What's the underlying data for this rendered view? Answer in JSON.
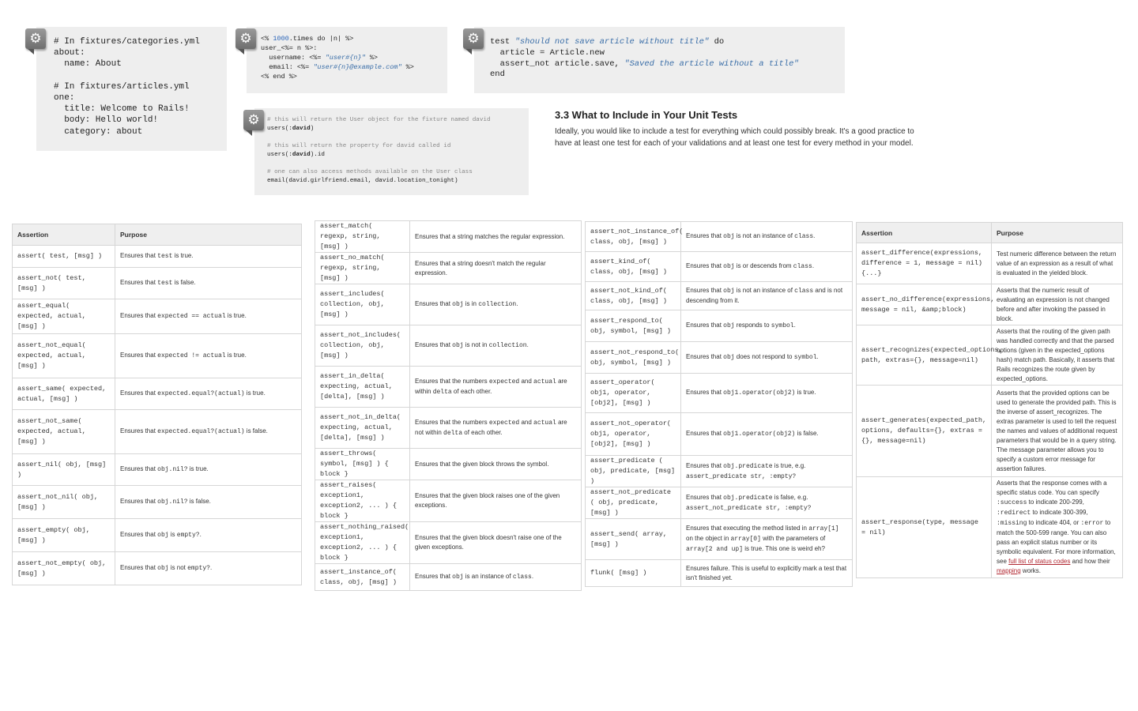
{
  "snippets": {
    "fixtures": [
      {
        "t": "# In fixtures/categories.yml"
      },
      {
        "t": "about:"
      },
      {
        "t": "  name: About"
      },
      {
        "t": ""
      },
      {
        "t": "# In fixtures/articles.yml"
      },
      {
        "t": "one:"
      },
      {
        "t": "  title: Welcome to Rails!"
      },
      {
        "t": "  body: Hello world!"
      },
      {
        "t": "  category: about"
      }
    ],
    "erb": [
      {
        "a": "<% ",
        "num": "1000",
        "b": ".times do |n| %>"
      },
      {
        "a": "user_<%= n %>:"
      },
      {
        "a": "  username: <%= ",
        "str": "\"user#{n}\"",
        "b": " %>"
      },
      {
        "a": "  email: <%= ",
        "str": "\"user#{n}@example.com\"",
        "b": " %>"
      },
      {
        "a": "<% end %>"
      }
    ],
    "test": [
      {
        "a": "test ",
        "str": "\"should not save article without title\"",
        "b": " do"
      },
      {
        "a": "  article = Article.new"
      },
      {
        "a": "  assert_not article.save, ",
        "str": "\"Saved the article without a title\""
      },
      {
        "a": "end"
      }
    ],
    "users": [
      {
        "cmt": "# this will return the User object for the fixture named david"
      },
      {
        "a": "users(:",
        "bold": "david",
        "b": ")"
      },
      {
        "a": ""
      },
      {
        "cmt": "# this will return the property for david called id"
      },
      {
        "a": "users(:",
        "bold": "david",
        "b": ").id"
      },
      {
        "a": ""
      },
      {
        "cmt": "# one can also access methods available on the User class"
      },
      {
        "a": "email(david.girlfriend.email, david.location_tonight)"
      }
    ]
  },
  "section": {
    "heading": "3.3 What to Include in Your Unit Tests",
    "paragraph": "Ideally, you would like to include a test for everything which could possibly break. It's a good practice to have at least one test for each of your validations and at least one test for every method in your model."
  },
  "table_headers": {
    "assertion": "Assertion",
    "purpose": "Purpose"
  },
  "table1": [
    {
      "m": "assert( test, [msg] )",
      "p": [
        {
          "t": "Ensures that "
        },
        {
          "c": "test"
        },
        {
          "t": " is true."
        }
      ]
    },
    {
      "m": "assert_not( test, [msg] )",
      "p": [
        {
          "t": "Ensures that "
        },
        {
          "c": "test"
        },
        {
          "t": " is false."
        }
      ]
    },
    {
      "m": "assert_equal( expected, actual, [msg] )",
      "p": [
        {
          "t": "Ensures that "
        },
        {
          "c": "expected == actual"
        },
        {
          "t": " is true."
        }
      ]
    },
    {
      "m": "assert_not_equal( expected, actual, [msg] )",
      "p": [
        {
          "t": "Ensures that "
        },
        {
          "c": "expected != actual"
        },
        {
          "t": " is true."
        }
      ]
    },
    {
      "m": "assert_same( expected, actual, [msg] )",
      "p": [
        {
          "t": "Ensures that "
        },
        {
          "c": "expected.equal?(actual)"
        },
        {
          "t": " is true."
        }
      ]
    },
    {
      "m": "assert_not_same( expected, actual, [msg] )",
      "p": [
        {
          "t": "Ensures that "
        },
        {
          "c": "expected.equal?(actual)"
        },
        {
          "t": " is false."
        }
      ]
    },
    {
      "m": "assert_nil( obj, [msg] )",
      "p": [
        {
          "t": "Ensures that "
        },
        {
          "c": "obj.nil?"
        },
        {
          "t": " is true."
        }
      ]
    },
    {
      "m": "assert_not_nil( obj, [msg] )",
      "p": [
        {
          "t": "Ensures that "
        },
        {
          "c": "obj.nil?"
        },
        {
          "t": " is false."
        }
      ]
    },
    {
      "m": "assert_empty( obj, [msg] )",
      "p": [
        {
          "t": "Ensures that "
        },
        {
          "c": "obj"
        },
        {
          "t": " is "
        },
        {
          "c": "empty?"
        },
        {
          "t": "."
        }
      ]
    },
    {
      "m": "assert_not_empty( obj, [msg] )",
      "p": [
        {
          "t": "Ensures that "
        },
        {
          "c": "obj"
        },
        {
          "t": " is not "
        },
        {
          "c": "empty?"
        },
        {
          "t": "."
        }
      ]
    }
  ],
  "table2": [
    {
      "m": "assert_match( regexp, string, [msg] )",
      "p": [
        {
          "t": "Ensures that a string matches the regular expression."
        }
      ]
    },
    {
      "m": "assert_no_match( regexp, string, [msg] )",
      "p": [
        {
          "t": "Ensures that a string doesn't match the regular expression."
        }
      ]
    },
    {
      "m": "assert_includes( collection, obj, [msg] )",
      "p": [
        {
          "t": "Ensures that "
        },
        {
          "c": "obj"
        },
        {
          "t": " is in "
        },
        {
          "c": "collection"
        },
        {
          "t": "."
        }
      ]
    },
    {
      "m": "assert_not_includes( collection, obj, [msg] )",
      "p": [
        {
          "t": "Ensures that "
        },
        {
          "c": "obj"
        },
        {
          "t": " is not in "
        },
        {
          "c": "collection"
        },
        {
          "t": "."
        }
      ]
    },
    {
      "m": "assert_in_delta( expecting, actual, [delta], [msg] )",
      "p": [
        {
          "t": "Ensures that the numbers "
        },
        {
          "c": "expected"
        },
        {
          "t": " and "
        },
        {
          "c": "actual"
        },
        {
          "t": " are within "
        },
        {
          "c": "delta"
        },
        {
          "t": " of each other."
        }
      ]
    },
    {
      "m": "assert_not_in_delta( expecting, actual, [delta], [msg] )",
      "p": [
        {
          "t": "Ensures that the numbers "
        },
        {
          "c": "expected"
        },
        {
          "t": " and "
        },
        {
          "c": "actual"
        },
        {
          "t": " are not within "
        },
        {
          "c": "delta"
        },
        {
          "t": " of each other."
        }
      ]
    },
    {
      "m": "assert_throws( symbol, [msg] ) { block }",
      "p": [
        {
          "t": "Ensures that the given block throws the symbol."
        }
      ]
    },
    {
      "m": "assert_raises( exception1, exception2, ... ) { block }",
      "p": [
        {
          "t": "Ensures that the given block raises one of the given exceptions."
        }
      ]
    },
    {
      "m": "assert_nothing_raised( exception1, exception2, ... ) { block }",
      "p": [
        {
          "t": "Ensures that the given block doesn't raise one of the given exceptions."
        }
      ]
    },
    {
      "m": "assert_instance_of( class, obj, [msg] )",
      "p": [
        {
          "t": "Ensures that "
        },
        {
          "c": "obj"
        },
        {
          "t": " is an instance of "
        },
        {
          "c": "class"
        },
        {
          "t": "."
        }
      ]
    }
  ],
  "table3": [
    {
      "m": "assert_not_instance_of( class, obj, [msg] )",
      "p": [
        {
          "t": "Ensures that "
        },
        {
          "c": "obj"
        },
        {
          "t": " is not an instance of "
        },
        {
          "c": "class"
        },
        {
          "t": "."
        }
      ]
    },
    {
      "m": "assert_kind_of( class, obj, [msg] )",
      "p": [
        {
          "t": "Ensures that "
        },
        {
          "c": "obj"
        },
        {
          "t": " is or descends from "
        },
        {
          "c": "class"
        },
        {
          "t": "."
        }
      ]
    },
    {
      "m": "assert_not_kind_of( class, obj, [msg] )",
      "p": [
        {
          "t": "Ensures that "
        },
        {
          "c": "obj"
        },
        {
          "t": " is not an instance of "
        },
        {
          "c": "class"
        },
        {
          "t": " and is not descending from it."
        }
      ]
    },
    {
      "m": "assert_respond_to( obj, symbol, [msg] )",
      "p": [
        {
          "t": "Ensures that "
        },
        {
          "c": "obj"
        },
        {
          "t": " responds to "
        },
        {
          "c": "symbol"
        },
        {
          "t": "."
        }
      ]
    },
    {
      "m": "assert_not_respond_to( obj, symbol, [msg] )",
      "p": [
        {
          "t": "Ensures that "
        },
        {
          "c": "obj"
        },
        {
          "t": " does not respond to "
        },
        {
          "c": "symbol"
        },
        {
          "t": "."
        }
      ]
    },
    {
      "m": "assert_operator( obj1, operator, [obj2], [msg] )",
      "p": [
        {
          "t": "Ensures that "
        },
        {
          "c": "obj1.operator(obj2)"
        },
        {
          "t": " is true."
        }
      ]
    },
    {
      "m": "assert_not_operator( obj1, operator, [obj2], [msg] )",
      "p": [
        {
          "t": "Ensures that "
        },
        {
          "c": "obj1.operator(obj2)"
        },
        {
          "t": " is false."
        }
      ]
    },
    {
      "m": "assert_predicate ( obj, predicate, [msg] )",
      "p": [
        {
          "t": "Ensures that "
        },
        {
          "c": "obj.predicate"
        },
        {
          "t": " is true, e.g. "
        },
        {
          "c": "assert_predicate str, :empty?"
        }
      ]
    },
    {
      "m": "assert_not_predicate ( obj, predicate, [msg] )",
      "p": [
        {
          "t": "Ensures that "
        },
        {
          "c": "obj.predicate"
        },
        {
          "t": " is false, e.g. "
        },
        {
          "c": "assert_not_predicate str, :empty?"
        }
      ]
    },
    {
      "m": "assert_send( array, [msg] )",
      "p": [
        {
          "t": "Ensures that executing the method listed in "
        },
        {
          "c": "array[1]"
        },
        {
          "t": " on the object in "
        },
        {
          "c": "array[0]"
        },
        {
          "t": " with the parameters of "
        },
        {
          "c": "array[2 and up]"
        },
        {
          "t": " is true. This one is weird eh?"
        }
      ]
    },
    {
      "m": "flunk( [msg] )",
      "p": [
        {
          "t": "Ensures failure. This is useful to explicitly mark a test that isn't finished yet."
        }
      ]
    }
  ],
  "table4": [
    {
      "m": "assert_difference(expressions, difference = 1, message = nil) {...}",
      "p": [
        {
          "t": "Test numeric difference between the return value of an expression as a result of what is evaluated in the yielded block."
        }
      ]
    },
    {
      "m": "assert_no_difference(expressions, message = nil, &amp;block)",
      "p": [
        {
          "t": "Asserts that the numeric result of evaluating an expression is not changed before and after invoking the passed in block."
        }
      ]
    },
    {
      "m": "assert_recognizes(expected_options, path, extras={}, message=nil)",
      "p": [
        {
          "t": "Asserts that the routing of the given path was handled correctly and that the parsed options (given in the expected_options hash) match path. Basically, it asserts that Rails recognizes the route given by expected_options."
        }
      ]
    },
    {
      "m": "assert_generates(expected_path, options, defaults={}, extras = {}, message=nil)",
      "p": [
        {
          "t": "Asserts that the provided options can be used to generate the provided path. This is the inverse of assert_recognizes. The extras parameter is used to tell the request the names and values of additional request parameters that would be in a query string. The message parameter allows you to specify a custom error message for assertion failures."
        }
      ]
    },
    {
      "m": "assert_response(type, message = nil)",
      "p": [
        {
          "t": "Asserts that the response comes with a specific status code. You can specify "
        },
        {
          "c": ":success"
        },
        {
          "t": " to indicate 200-299, "
        },
        {
          "c": ":redirect"
        },
        {
          "t": " to indicate 300-399, "
        },
        {
          "c": ":missing"
        },
        {
          "t": " to indicate 404, or "
        },
        {
          "c": ":error"
        },
        {
          "t": " to match the 500-599 range. You can also pass an explicit status number or its symbolic equivalent. For more information, see "
        },
        {
          "l": "full list of status codes"
        },
        {
          "t": " and how their "
        },
        {
          "l": "mapping"
        },
        {
          "t": " works."
        }
      ]
    }
  ]
}
